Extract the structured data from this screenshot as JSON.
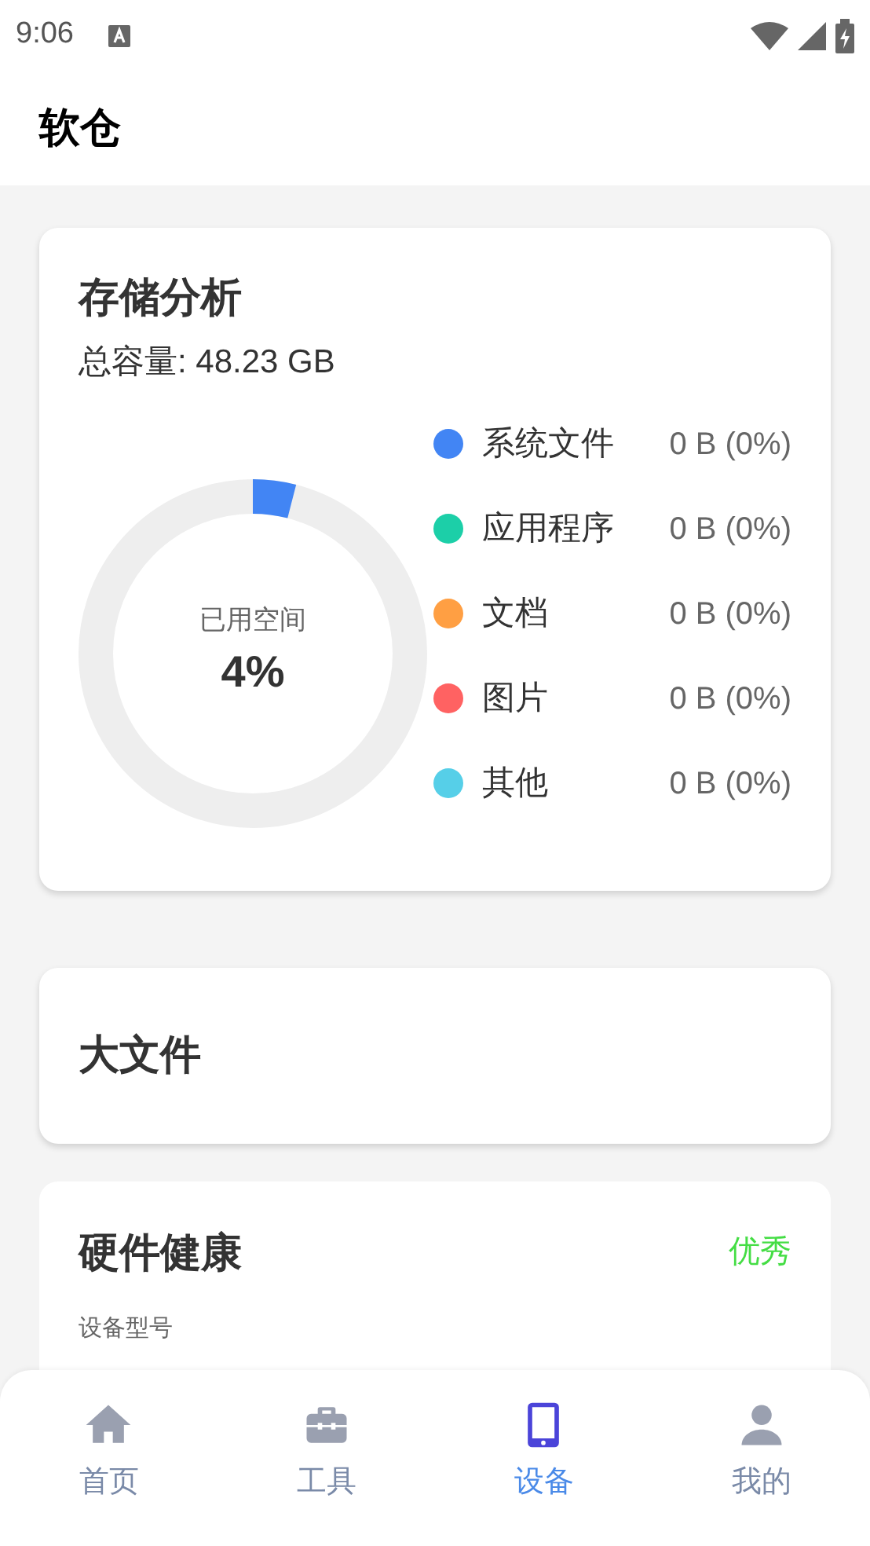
{
  "status_bar": {
    "time": "9:06"
  },
  "header": {
    "title": "软仓"
  },
  "storage": {
    "title": "存储分析",
    "total": "总容量: 48.23 GB",
    "used_label": "已用空间",
    "used_percent": "4%",
    "level": 0.04,
    "legend": [
      {
        "name": "系统文件",
        "value": "0 B (0%)",
        "color": "#4285f4"
      },
      {
        "name": "应用程序",
        "value": "0 B (0%)",
        "color": "#1ccfa8"
      },
      {
        "name": "文档",
        "value": "0 B (0%)",
        "color": "#ff9f43"
      },
      {
        "name": "图片",
        "value": "0 B (0%)",
        "color": "#ff6262"
      },
      {
        "name": "其他",
        "value": "0 B (0%)",
        "color": "#56cfe8"
      }
    ]
  },
  "large_files": {
    "title": "大文件"
  },
  "hardware": {
    "title": "硬件健康",
    "status": "优秀",
    "field_label": "设备型号"
  },
  "nav": [
    {
      "kind": "home",
      "label": "首页",
      "selected": false
    },
    {
      "kind": "tools",
      "label": "工具",
      "selected": false
    },
    {
      "kind": "device",
      "label": "设备",
      "selected": true
    },
    {
      "kind": "profile",
      "label": "我的",
      "selected": false
    }
  ]
}
